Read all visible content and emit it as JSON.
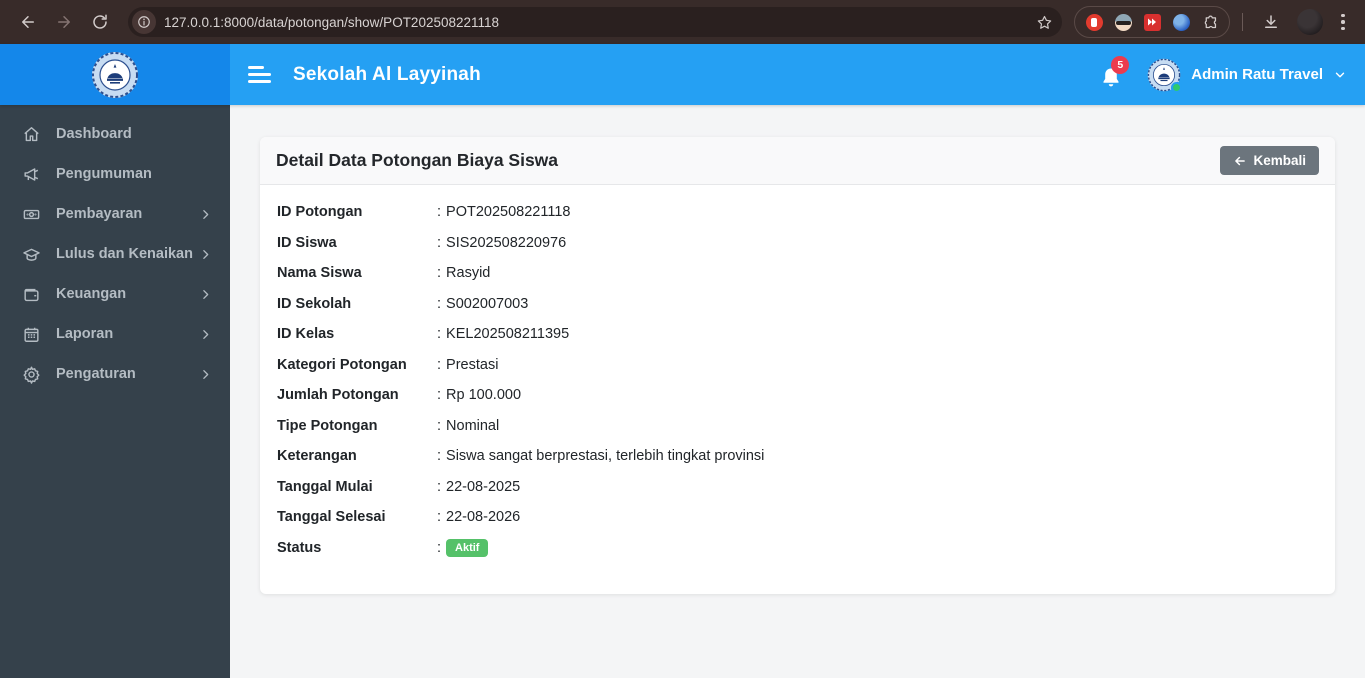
{
  "browser": {
    "url": "127.0.0.1:8000/data/potongan/show/POT202508221118"
  },
  "header": {
    "title": "Sekolah Al Layyinah",
    "notification_count": "5",
    "user_name": "Admin Ratu Travel"
  },
  "sidebar": {
    "items": [
      {
        "label": "Dashboard",
        "icon": "home-icon",
        "has_submenu": false
      },
      {
        "label": "Pengumuman",
        "icon": "megaphone-icon",
        "has_submenu": false
      },
      {
        "label": "Pembayaran",
        "icon": "banknote-icon",
        "has_submenu": true
      },
      {
        "label": "Lulus dan Kenaikan",
        "icon": "graduation-cap-icon",
        "has_submenu": true
      },
      {
        "label": "Keuangan",
        "icon": "wallet-icon",
        "has_submenu": true
      },
      {
        "label": "Laporan",
        "icon": "calendar-icon",
        "has_submenu": true
      },
      {
        "label": "Pengaturan",
        "icon": "gear-icon",
        "has_submenu": true
      }
    ]
  },
  "card": {
    "title": "Detail Data Potongan Biaya Siswa",
    "back_button_label": "Kembali",
    "fields": [
      {
        "label": "ID Potongan",
        "value": "POT202508221118"
      },
      {
        "label": "ID Siswa",
        "value": "SIS202508220976"
      },
      {
        "label": "Nama Siswa",
        "value": "Rasyid"
      },
      {
        "label": "ID Sekolah",
        "value": "S002007003"
      },
      {
        "label": "ID Kelas",
        "value": "KEL202508211395"
      },
      {
        "label": "Kategori Potongan",
        "value": "Prestasi"
      },
      {
        "label": "Jumlah Potongan",
        "value": "Rp 100.000"
      },
      {
        "label": "Tipe Potongan",
        "value": "Nominal"
      },
      {
        "label": "Keterangan",
        "value": "Siswa sangat berprestasi, terlebih tingkat provinsi"
      },
      {
        "label": "Tanggal Mulai",
        "value": "22-08-2025"
      },
      {
        "label": "Tanggal Selesai",
        "value": "22-08-2026"
      },
      {
        "label": "Status",
        "value": "Aktif",
        "type": "badge"
      }
    ]
  },
  "colors": {
    "header_blue": "#25a0f3",
    "brand_blue": "#1487ea",
    "sidebar_dark": "#35414b",
    "badge_green": "#55c169",
    "notification_red": "#ec3b4e",
    "back_button_gray": "#6c757d"
  }
}
